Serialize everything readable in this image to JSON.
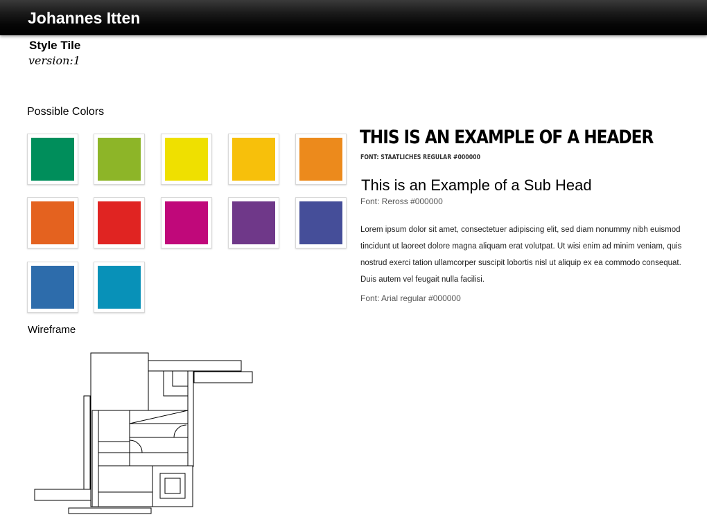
{
  "header": {
    "title": "Johannes Itten"
  },
  "tile": {
    "label": "Style Tile",
    "version": "version:1"
  },
  "colors_section": {
    "label": "Possible Colors",
    "swatches": [
      "#008e5b",
      "#8db528",
      "#efe000",
      "#f7c00b",
      "#ec8a1c",
      "#e4621f",
      "#e02422",
      "#c0087a",
      "#6f3889",
      "#454e99",
      "#2d6cab",
      "#0891b8"
    ]
  },
  "typography": {
    "header_example": "This is an example of a header",
    "header_caption": "Font: Staatliches regular #000000",
    "subhead_example": "This is an Example of a Sub Head",
    "subhead_caption": "Font: Reross #000000",
    "body_example": "Lorem ipsum dolor sit amet, consectetuer adipiscing elit, sed diam nonummy nibh euismod tincidunt ut laoreet dolore magna aliquam erat volutpat. Ut wisi enim ad minim veniam, quis nostrud exerci tation ullamcorper suscipit lobortis nisl ut aliquip ex ea commodo consequat. Duis autem vel feugait nulla facilisi.",
    "body_caption": "Font: Arial regular #000000"
  },
  "wireframe_section": {
    "label": "Wireframe"
  }
}
